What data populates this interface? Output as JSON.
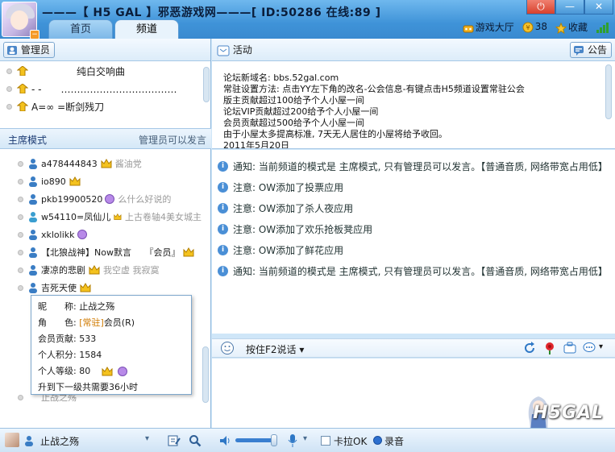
{
  "header": {
    "title": "———【 H5 GAL 】邪恶游戏网———[ ID:50286 在线:89 ]",
    "tabs": [
      {
        "label": "首页"
      },
      {
        "label": "频道"
      }
    ],
    "game_hall": "游戏大厅",
    "coins": "38",
    "favorite": "收藏"
  },
  "left": {
    "admin_label": "管理员",
    "admins": [
      {
        "name": "纯白交响曲"
      },
      {
        "name": "- -　　………………………………"
      },
      {
        "name": "A=∞ =断剑残刀"
      }
    ],
    "mode_label": "主席模式",
    "mode_note": "管理员可以发言",
    "users": [
      {
        "name": "a478444843",
        "note": "酱油党"
      },
      {
        "name": "io890",
        "note": ""
      },
      {
        "name": "pkb19900520",
        "note": "么什么好说的"
      },
      {
        "name": "w54110=凤仙儿",
        "note": "上古卷轴4美女城主"
      },
      {
        "name": "xklolikk",
        "note": ""
      },
      {
        "name": "【北狼战神】Now默言　　『会员』",
        "note": ""
      },
      {
        "name": "凄凉的悲剧",
        "note": "我空虚 我寂寞"
      },
      {
        "name": "吉死天使",
        "note": ""
      }
    ],
    "tooltip": {
      "nick_label": "昵　　称:",
      "nick": "止战之殇",
      "role_label": "角　　色:",
      "role_tag": "[常驻]",
      "role": "会员(R)",
      "contrib_label": "会员贡献:",
      "contrib": "533",
      "points_label": "个人积分:",
      "points": "1584",
      "level_label": "个人等级:",
      "level": "80",
      "next_level": "升到下一级共需要36小时"
    },
    "hidden_row": "止战之殇"
  },
  "right": {
    "activity_label": "活动",
    "notice_label": "公告",
    "notice_lines": [
      "论坛新域名: bbs.52gal.com",
      "常驻设置方法: 点击YY左下角的改名-公会信息-有键点击H5频道设置常驻公会",
      "版主贡献超过100给予个人小屋一间",
      "论坛VIP贡献超过200给予个人小屋一间",
      "会员贡献超过500给予个人小屋一间",
      "由于小屋太多提高标准, 7天无人居住的小屋将给予收回。",
      "2011年5月20日"
    ],
    "messages": [
      {
        "text": "通知: 当前频道的模式是 主席模式, 只有管理员可以发言。【普通音质, 网络带宽占用低】"
      },
      {
        "text": "注意: OW添加了投票应用"
      },
      {
        "text": "注意: OW添加了杀人夜应用"
      },
      {
        "text": "注意: OW添加了欢乐抢板凳应用"
      },
      {
        "text": "注意: OW添加了鲜花应用"
      },
      {
        "text": "通知: 当前频道的模式是 主席模式, 只有管理员可以发言。【普通音质, 网络带宽占用低】"
      }
    ],
    "input_mode": "按住F2说话",
    "logo": "H5GAL"
  },
  "bottom": {
    "username": "止战之殇",
    "karaoke": "卡拉OK",
    "record": "录音",
    "volume": 0.95
  },
  "colors": {
    "accent": "#3f93d8",
    "crown": "#f3c31a",
    "link": "#1c3b73"
  }
}
